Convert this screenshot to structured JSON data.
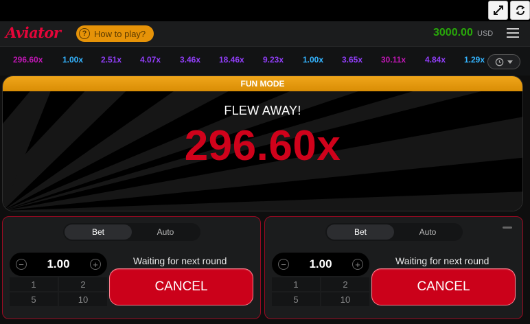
{
  "app": {
    "logo": "Aviator",
    "how_to_play": "How to play?",
    "balance": "3000.00",
    "currency": "USD"
  },
  "toolbar": {
    "fullscreen_icon": "expand-arrows-icon",
    "refresh_icon": "refresh-icon"
  },
  "history": {
    "items": [
      {
        "value": "296.60x",
        "color": "#c017b4"
      },
      {
        "value": "1.00x",
        "color": "#34b4ff"
      },
      {
        "value": "2.51x",
        "color": "#913ef8"
      },
      {
        "value": "4.07x",
        "color": "#913ef8"
      },
      {
        "value": "3.46x",
        "color": "#913ef8"
      },
      {
        "value": "18.46x",
        "color": "#913ef8"
      },
      {
        "value": "9.23x",
        "color": "#913ef8"
      },
      {
        "value": "1.00x",
        "color": "#34b4ff"
      },
      {
        "value": "3.65x",
        "color": "#913ef8"
      },
      {
        "value": "30.11x",
        "color": "#c017b4"
      },
      {
        "value": "4.84x",
        "color": "#913ef8"
      },
      {
        "value": "1.29x",
        "color": "#34b4ff"
      }
    ]
  },
  "game": {
    "mode_label": "FUN MODE",
    "status": "FLEW AWAY!",
    "multiplier": "296.60x",
    "multiplier_color": "#d0021b"
  },
  "panels": [
    {
      "tab_bet": "Bet",
      "tab_auto": "Auto",
      "amount": "1.00",
      "quick": [
        "1",
        "2",
        "5",
        "10"
      ],
      "status": "Waiting for next round",
      "button": "CANCEL"
    },
    {
      "tab_bet": "Bet",
      "tab_auto": "Auto",
      "amount": "1.00",
      "quick": [
        "1",
        "2",
        "5",
        "10"
      ],
      "status": "Waiting for next round",
      "button": "CANCEL"
    }
  ]
}
